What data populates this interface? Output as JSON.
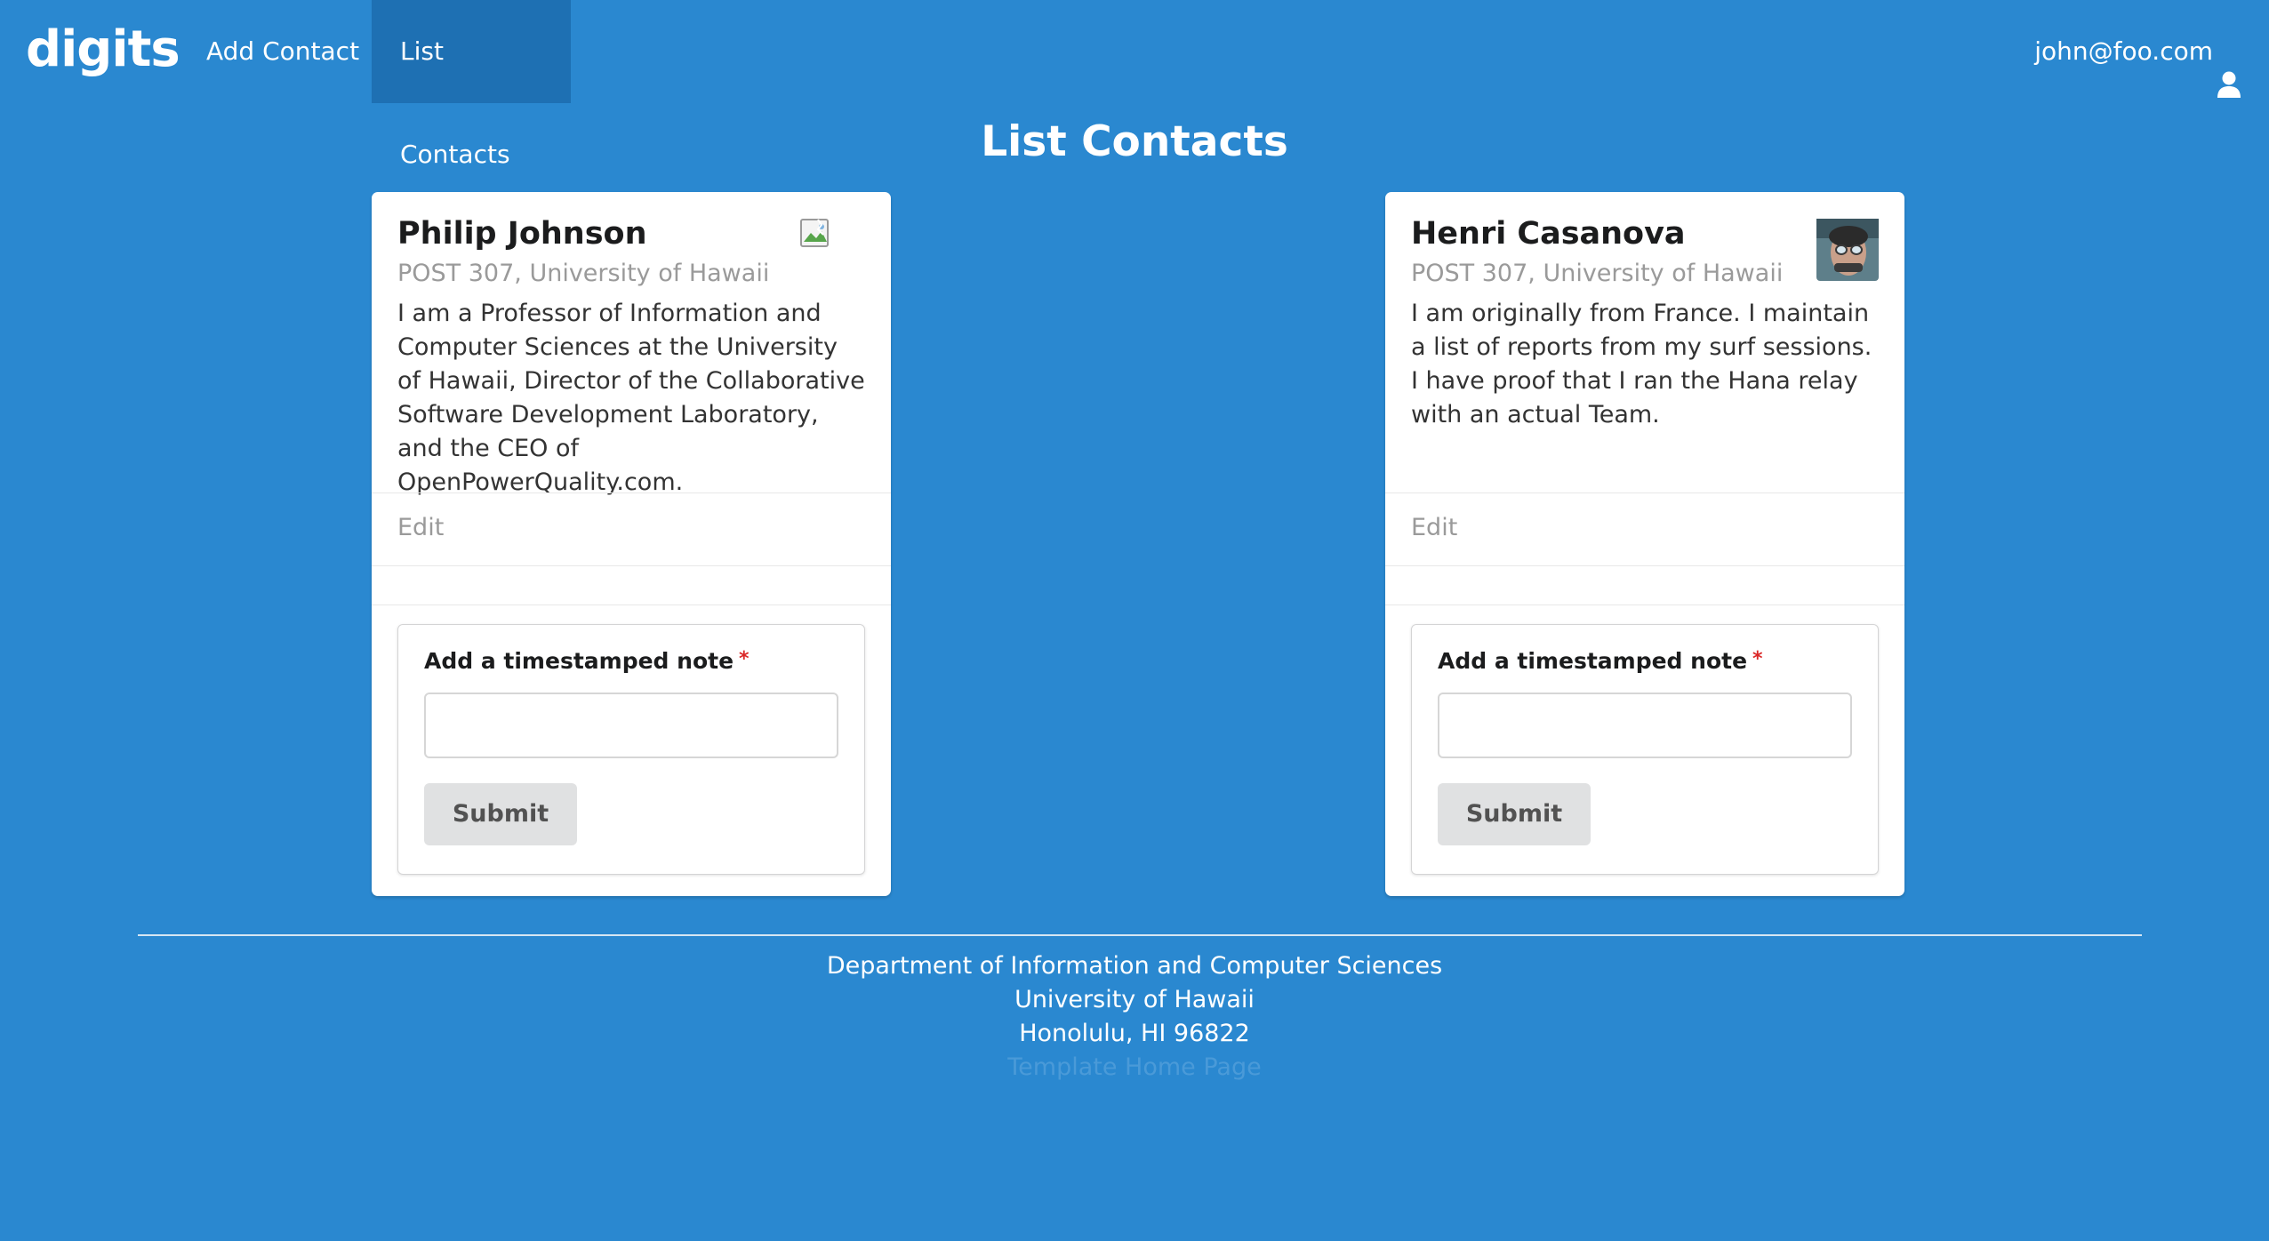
{
  "navbar": {
    "brand": "digits",
    "items": [
      {
        "label": "Add Contact",
        "active": false
      },
      {
        "label": "List Contacts",
        "active": true
      }
    ],
    "user": "john@foo.com",
    "user_icon": "user-icon"
  },
  "page": {
    "title": "List Contacts"
  },
  "contacts": [
    {
      "name": "Philip Johnson",
      "address": "POST 307, University of Hawaii",
      "description": "I am a Professor of Information and Computer Sciences at the University of Hawaii, Director of the Collaborative Software Development Laboratory, and the CEO of OpenPowerQuality.com.",
      "image": "broken-image",
      "edit_label": "Edit",
      "note_label": "Add a timestamped note",
      "note_value": "",
      "submit_label": "Submit"
    },
    {
      "name": "Henri Casanova",
      "address": "POST 307, University of Hawaii",
      "description": "I am originally from France. I maintain a list of reports from my surf sessions. I have proof that I ran the Hana relay with an actual Team.",
      "image": "portrait-photo",
      "edit_label": "Edit",
      "note_label": "Add a timestamped note",
      "note_value": "",
      "submit_label": "Submit"
    }
  ],
  "footer": {
    "line1": "Department of Information and Computer Sciences",
    "line2": "University of Hawaii",
    "line3": "Honolulu, HI 96822",
    "link": "Template Home Page"
  },
  "colors": {
    "background": "#2a88d0",
    "active_nav": "#1e70b3",
    "card": "#ffffff",
    "required": "#db2828",
    "button": "#e0e1e2"
  }
}
